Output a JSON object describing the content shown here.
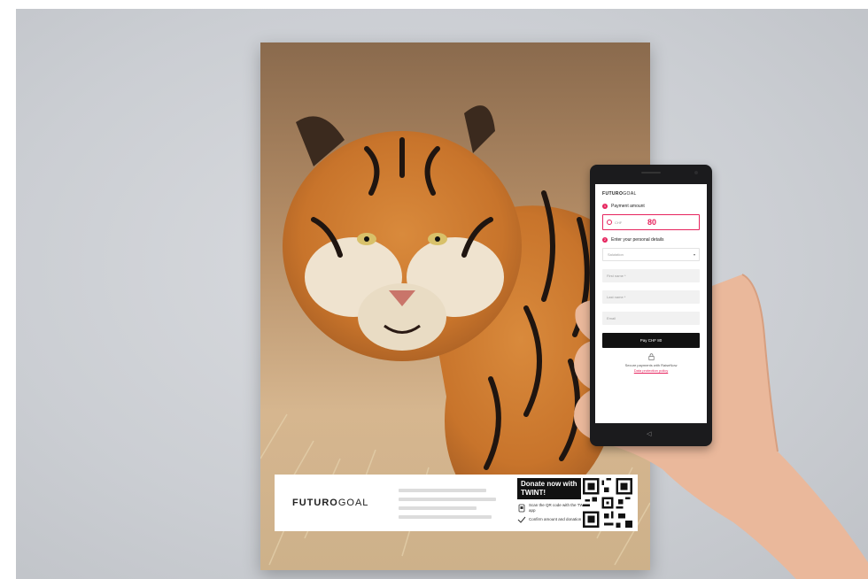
{
  "poster": {
    "brand_bold": "FUTURO",
    "brand_light": "GOAL",
    "twint_title_line1": "Donate now with",
    "twint_title_line2": "TWINT!",
    "step1": "Scan the QR code with the TWINT app",
    "step2": "Confirm amount and donation"
  },
  "phone": {
    "brand_bold": "FUTURO",
    "brand_light": "GOAL",
    "step1_num": "1",
    "step1_label": "Payment amount",
    "currency": "CHF",
    "amount": "80",
    "step2_num": "2",
    "step2_label": "Enter your personal details",
    "salutation": "Salutation",
    "first_name": "First name *",
    "last_name": "Last name *",
    "email": "Email",
    "pay_button": "Pay CHF 80",
    "secure_text": "Secure payments with RaiseNow",
    "privacy_link": "Data protection policy",
    "back_icon": "◁"
  },
  "colors": {
    "accent": "#e6245e",
    "button": "#111111"
  }
}
